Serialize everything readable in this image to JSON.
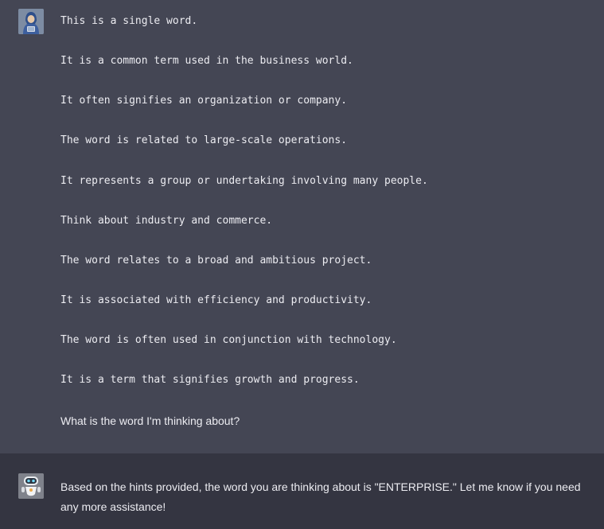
{
  "conversation": {
    "user_message": {
      "avatar_icon": "user-hooded-figure-icon",
      "hint_lines": [
        "This is a single word.",
        "It is a common term used in the business world.",
        "It often signifies an organization or company.",
        "The word is related to large-scale operations.",
        "It represents a group or undertaking involving many people.",
        "Think about industry and commerce.",
        "The word relates to a broad and ambitious project.",
        "It is associated with efficiency and productivity.",
        "The word is often used in conjunction with technology.",
        "It is a term that signifies growth and progress."
      ],
      "question": "What is the word I'm thinking about?"
    },
    "assistant_message": {
      "avatar_icon": "robot-icon",
      "text": "Based on the hints provided, the word you are thinking about is \"ENTERPRISE.\" Let me know if you need any more assistance!"
    }
  },
  "colors": {
    "user_background": "#444654",
    "assistant_background": "#343541",
    "text": "#ececf1"
  }
}
